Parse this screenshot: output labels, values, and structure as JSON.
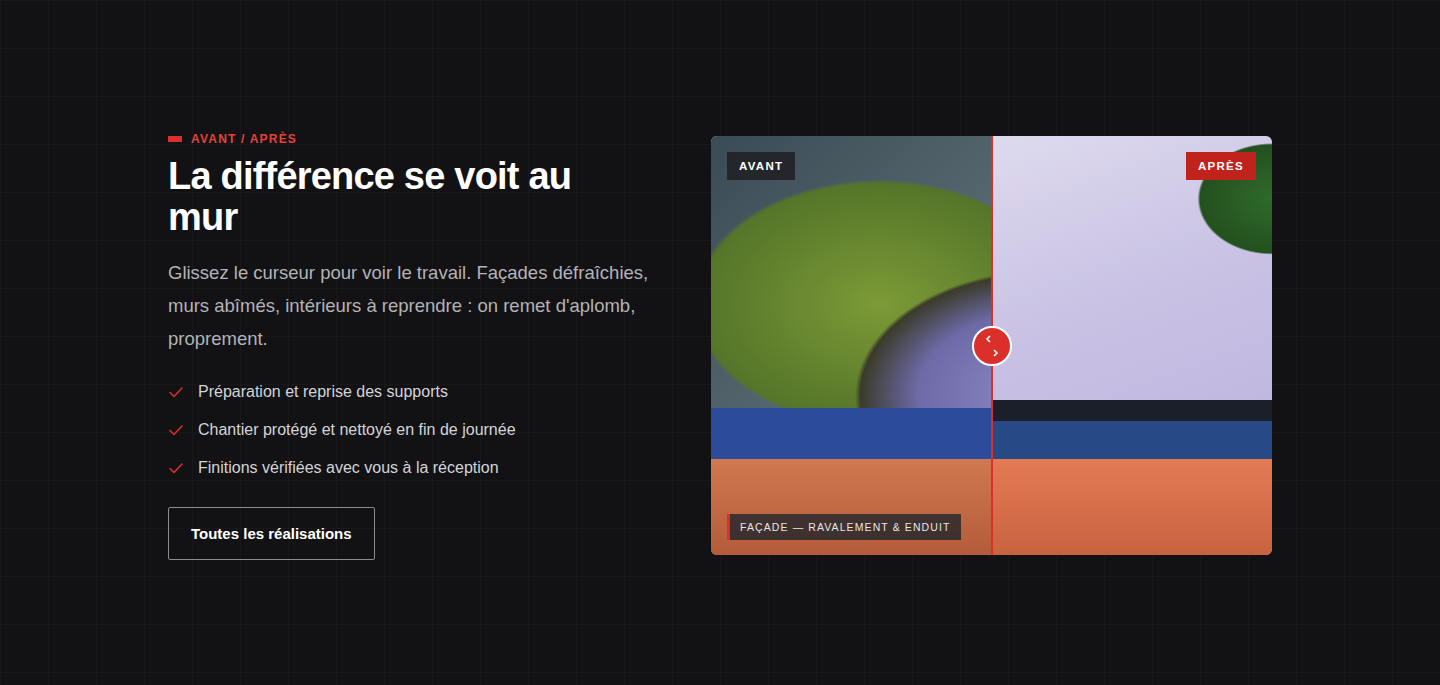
{
  "eyebrow": "AVANT / APRÈS",
  "title": "La différence se voit au mur",
  "intro": "Glissez le curseur pour voir le travail. Façades défraîchies, murs abîmés, intérieurs à reprendre : on remet d'aplomb, proprement.",
  "features": [
    "Préparation et reprise des supports",
    "Chantier protégé et nettoyé en fin de journée",
    "Finitions vérifiées avec vous à la réception"
  ],
  "button": "Toutes les réalisations",
  "comparison": {
    "before_label": "AVANT",
    "after_label": "APRÈS",
    "caption": "FAÇADE — RAVALEMENT & ENDUIT",
    "level": 0.5
  }
}
